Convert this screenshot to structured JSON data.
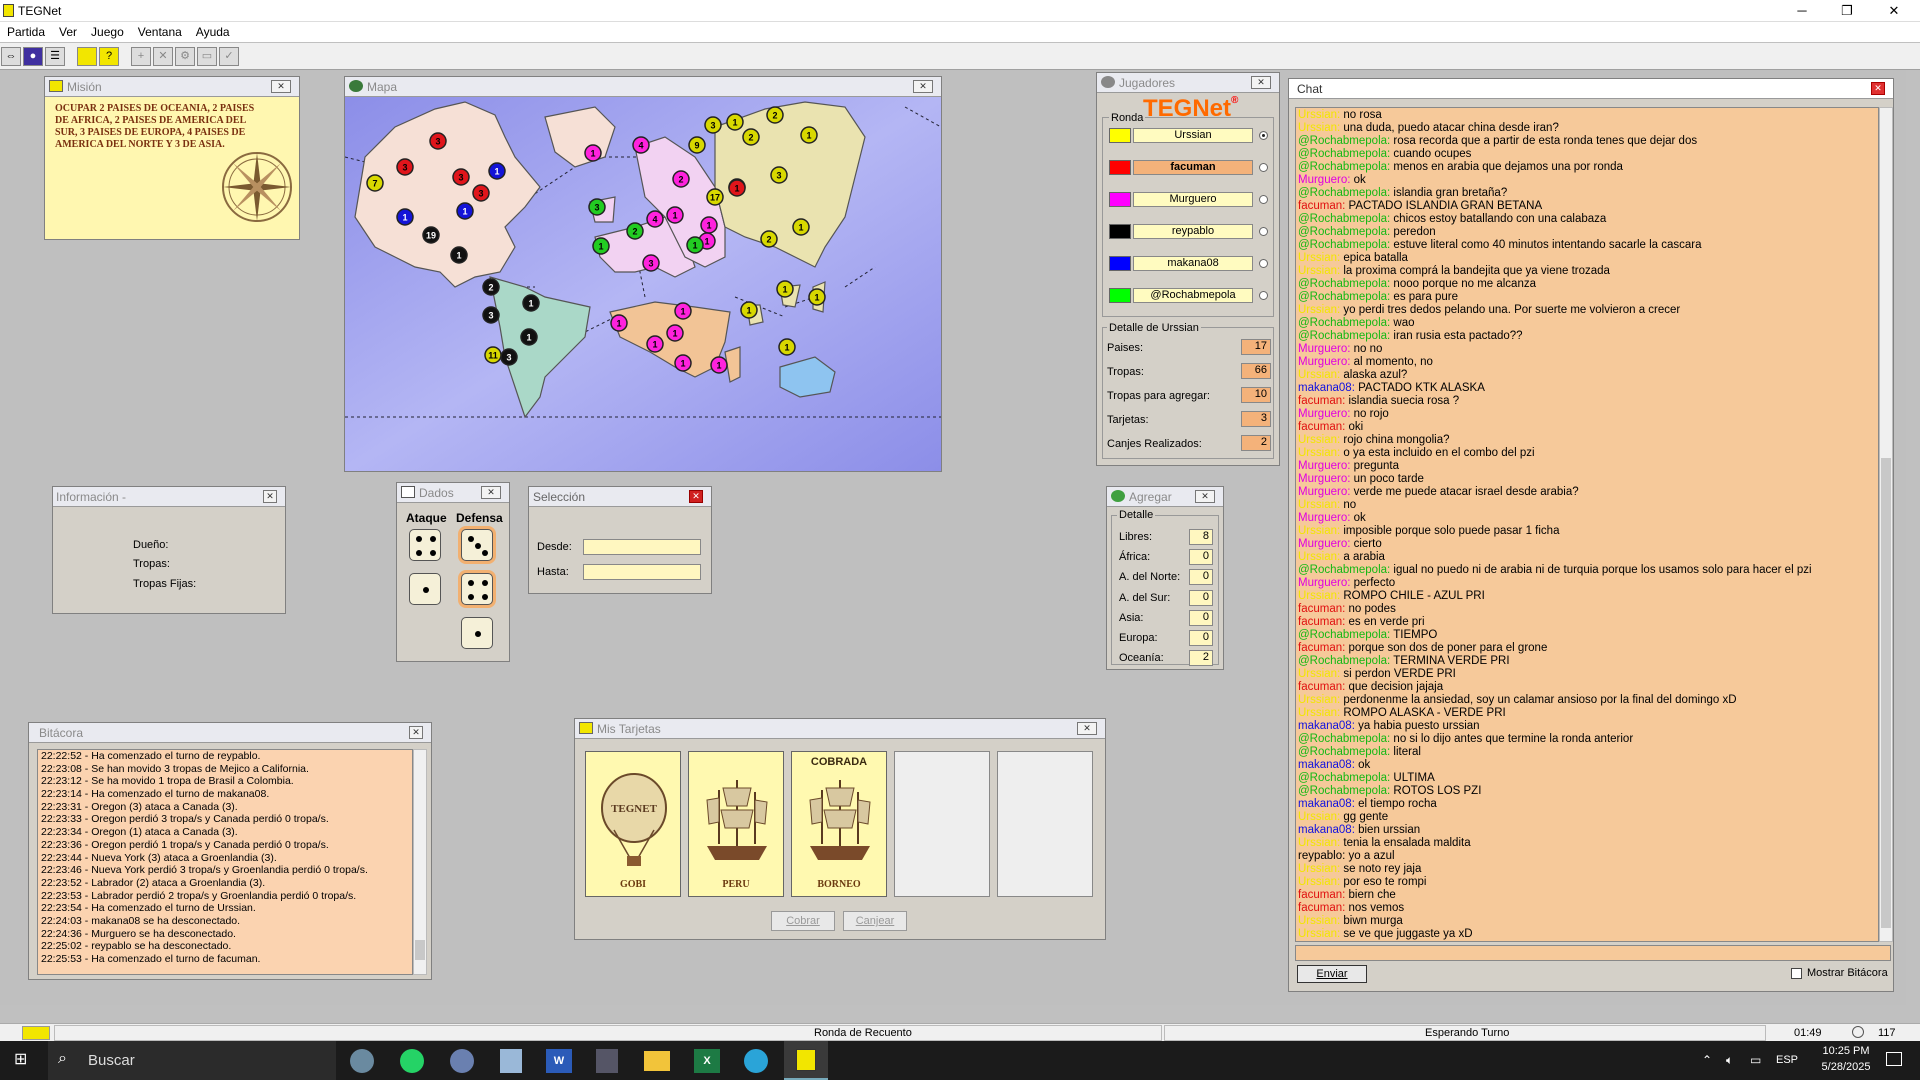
{
  "window": {
    "title": "TEGNet",
    "min": "─",
    "max": "❐",
    "close": "✕"
  },
  "menu": [
    "Partida",
    "Ver",
    "Juego",
    "Ventana",
    "Ayuda"
  ],
  "mission": {
    "title": "Misión",
    "text": "OCUPAR 2 PAISES DE OCEANIA, 2 PAISES DE AFRICA, 2 PAISES DE AMERICA DEL SUR, 3 PAISES DE EUROPA, 4 PAISES DE AMERICA DEL NORTE Y 3 DE ASIA."
  },
  "map": {
    "title": "Mapa",
    "tokens": [
      {
        "n": "3",
        "c": "#e0151b"
      },
      {
        "n": "3",
        "c": "#e0151b"
      },
      {
        "n": "3",
        "c": "#e0151b"
      },
      {
        "n": "3",
        "c": "#e0151b"
      },
      {
        "n": "7",
        "c": "#d8d800"
      },
      {
        "n": "1",
        "c": "#1414d8"
      },
      {
        "n": "1",
        "c": "#1414d8"
      },
      {
        "n": "1",
        "c": "#1414d8"
      },
      {
        "n": "19",
        "c": "#111"
      },
      {
        "n": "1",
        "c": "#111"
      },
      {
        "n": "2",
        "c": "#111"
      },
      {
        "n": "1",
        "c": "#111"
      },
      {
        "n": "3",
        "c": "#111"
      },
      {
        "n": "1",
        "c": "#111"
      },
      {
        "n": "3",
        "c": "#111"
      },
      {
        "n": "11",
        "c": "#d8d800"
      },
      {
        "n": "1",
        "c": "#ff22dd"
      },
      {
        "n": "4",
        "c": "#ff22dd"
      },
      {
        "n": "2",
        "c": "#ff22dd"
      },
      {
        "n": "4",
        "c": "#ff22dd"
      },
      {
        "n": "1",
        "c": "#ff22dd"
      },
      {
        "n": "1",
        "c": "#ff22dd"
      },
      {
        "n": "1",
        "c": "#ff22dd"
      },
      {
        "n": "3",
        "c": "#ff22dd"
      },
      {
        "n": "3",
        "c": "#22cc22"
      },
      {
        "n": "2",
        "c": "#22cc22"
      },
      {
        "n": "1",
        "c": "#22cc22"
      },
      {
        "n": "1",
        "c": "#22cc22"
      },
      {
        "n": "3",
        "c": "#d8d800"
      },
      {
        "n": "1",
        "c": "#d8d800"
      },
      {
        "n": "2",
        "c": "#d8d800"
      },
      {
        "n": "9",
        "c": "#d8d800"
      },
      {
        "n": "2",
        "c": "#d8d800"
      },
      {
        "n": "1",
        "c": "#d8d800"
      },
      {
        "n": "1",
        "c": "#d8d800"
      },
      {
        "n": "17",
        "c": "#d8d800"
      },
      {
        "n": "1",
        "c": "#e0151b"
      },
      {
        "n": "3",
        "c": "#d8d800"
      },
      {
        "n": "2",
        "c": "#d8d800"
      },
      {
        "n": "1",
        "c": "#d8d800"
      },
      {
        "n": "1",
        "c": "#ff22dd"
      },
      {
        "n": "1",
        "c": "#ff22dd"
      },
      {
        "n": "1",
        "c": "#ff22dd"
      },
      {
        "n": "1",
        "c": "#ff22dd"
      },
      {
        "n": "1",
        "c": "#ff22dd"
      },
      {
        "n": "1",
        "c": "#ff22dd"
      },
      {
        "n": "1",
        "c": "#d8d800"
      },
      {
        "n": "1",
        "c": "#d8d800"
      },
      {
        "n": "1",
        "c": "#d8d800"
      },
      {
        "n": "1",
        "c": "#d8d800"
      }
    ]
  },
  "players": {
    "title": "Jugadores",
    "logo": "TEGNet",
    "ronda": "Ronda",
    "list": [
      {
        "name": "Urssian",
        "color": "#ffff00",
        "bg": "#fffbc0"
      },
      {
        "name": "facuman",
        "color": "#ff0000",
        "bg": "#f4b27a"
      },
      {
        "name": "Murguero",
        "color": "#ff00ff",
        "bg": "#fffbc0"
      },
      {
        "name": "reypablo",
        "color": "#000000",
        "bg": "#fffbc0"
      },
      {
        "name": "makana08",
        "color": "#0000ff",
        "bg": "#fffbc0"
      },
      {
        "name": "@Rochabmepola",
        "color": "#00ff00",
        "bg": "#fffbc0"
      }
    ],
    "detail_title": "Detalle de Urssian",
    "detail": [
      {
        "k": "Paises:",
        "v": "17"
      },
      {
        "k": "Tropas:",
        "v": "66"
      },
      {
        "k": "Tropas para agregar:",
        "v": "10"
      },
      {
        "k": "Tarjetas:",
        "v": "3"
      },
      {
        "k": "Canjes Realizados:",
        "v": "2"
      }
    ]
  },
  "info": {
    "title": "Información -",
    "dueno": "Dueño:",
    "tropas": "Tropas:",
    "fijas": "Tropas Fijas:"
  },
  "dados": {
    "title": "Dados",
    "ataque": "Ataque",
    "defensa": "Defensa",
    "atk": [
      4,
      1
    ],
    "def": [
      3,
      4,
      1
    ]
  },
  "seleccion": {
    "title": "Selección",
    "desde": "Desde:",
    "hasta": "Hasta:"
  },
  "agregar": {
    "title": "Agregar",
    "detalle": "Detalle",
    "rows": [
      {
        "k": "Libres:",
        "v": "8"
      },
      {
        "k": "África:",
        "v": "0"
      },
      {
        "k": "A. del Norte:",
        "v": "0"
      },
      {
        "k": "A. del Sur:",
        "v": "0"
      },
      {
        "k": "Asia:",
        "v": "0"
      },
      {
        "k": "Europa:",
        "v": "0"
      },
      {
        "k": "Oceanía:",
        "v": "2"
      }
    ]
  },
  "bitacora": {
    "title": "Bitácora",
    "lines": [
      "22:22:52 - Ha comenzado el turno de reypablo.",
      "22:23:08 - Se han movido 3 tropas de Mejico a California.",
      "22:23:12 - Se ha movido 1 tropa de Brasil a Colombia.",
      "22:23:14 - Ha comenzado el turno de makana08.",
      "22:23:31 - Oregon (3) ataca a Canada (3).",
      "22:23:33 - Oregon perdió 3 tropa/s y Canada perdió 0 tropa/s.",
      "22:23:34 - Oregon (1) ataca a Canada (3).",
      "22:23:36 - Oregon perdió 1 tropa/s y Canada perdió 0 tropa/s.",
      "22:23:44 - Nueva York (3) ataca a Groenlandia (3).",
      "22:23:46 - Nueva York perdió 3 tropa/s y Groenlandia perdió 0 tropa/s.",
      "22:23:52 - Labrador (2) ataca a Groenlandia (3).",
      "22:23:53 - Labrador perdió 2 tropa/s y Groenlandia perdió 0 tropa/s.",
      "22:23:54 - Ha comenzado el turno de Urssian.",
      "22:24:03 - makana08 se ha desconectado.",
      "22:24:36 - Murguero se ha desconectado.",
      "22:25:02 - reypablo se ha desconectado.",
      "22:25:53 - Ha comenzado el turno de facuman."
    ]
  },
  "tarjetas": {
    "title": "Mis Tarjetas",
    "cards": [
      {
        "name": "GOBI",
        "top": "",
        "pic": "balloon"
      },
      {
        "name": "PERU",
        "top": "",
        "pic": "ship"
      },
      {
        "name": "BORNEO",
        "top": "COBRADA",
        "pic": "ship"
      }
    ],
    "cobrar": "Cobrar",
    "canjear": "Canjear"
  },
  "chat": {
    "title": "Chat",
    "send": "Enviar",
    "mostrar": "Mostrar Bitácora",
    "lines": [
      {
        "u": "Urssian",
        "t": "no rosa",
        "c": "#f2e600"
      },
      {
        "u": "Urssian",
        "t": "una duda, puedo atacar china desde iran?",
        "c": "#f2e600"
      },
      {
        "u": "@Rochabmepola",
        "t": "rosa recorda que a partir de esta ronda tenes que dejar dos",
        "c": "#14b814"
      },
      {
        "u": "@Rochabmepola",
        "t": "cuando ocupes",
        "c": "#14b814"
      },
      {
        "u": "@Rochabmepola",
        "t": "menos en arabia que dejamos una por ronda",
        "c": "#14b814"
      },
      {
        "u": "Murguero",
        "t": "ok",
        "c": "#e000e0"
      },
      {
        "u": "@Rochabmepola",
        "t": "islandia gran bretaña?",
        "c": "#14b814"
      },
      {
        "u": "facuman",
        "t": "PACTADO ISLANDIA GRAN BETANA",
        "c": "#e01010"
      },
      {
        "u": "@Rochabmepola",
        "t": "chicos estoy batallando con una calabaza",
        "c": "#14b814"
      },
      {
        "u": "@Rochabmepola",
        "t": "peredon",
        "c": "#14b814"
      },
      {
        "u": "@Rochabmepola",
        "t": "estuve literal como 40 minutos intentando sacarle la cascara",
        "c": "#14b814"
      },
      {
        "u": "Urssian",
        "t": "epica batalla",
        "c": "#f2e600"
      },
      {
        "u": "Urssian",
        "t": "la proxima comprá la bandejita que ya viene trozada",
        "c": "#f2e600"
      },
      {
        "u": "@Rochabmepola",
        "t": "nooo porque no me alcanza",
        "c": "#14b814"
      },
      {
        "u": "@Rochabmepola",
        "t": "es para pure",
        "c": "#14b814"
      },
      {
        "u": "Urssian",
        "t": "yo perdi tres dedos pelando una. Por suerte me volvieron a crecer",
        "c": "#f2e600"
      },
      {
        "u": "@Rochabmepola",
        "t": "wao",
        "c": "#14b814"
      },
      {
        "u": "@Rochabmepola",
        "t": "iran rusia esta pactado??",
        "c": "#14b814"
      },
      {
        "u": "Murguero",
        "t": "no no",
        "c": "#e000e0"
      },
      {
        "u": "Murguero",
        "t": "al momento, no",
        "c": "#e000e0"
      },
      {
        "u": "Urssian",
        "t": "alaska azul?",
        "c": "#f2e600"
      },
      {
        "u": "makana08",
        "t": "PACTADO KTK ALASKA",
        "c": "#1010e0"
      },
      {
        "u": "facuman",
        "t": "islandia suecia rosa ?",
        "c": "#e01010"
      },
      {
        "u": "Murguero",
        "t": "no rojo",
        "c": "#e000e0"
      },
      {
        "u": "facuman",
        "t": "oki",
        "c": "#e01010"
      },
      {
        "u": "Urssian",
        "t": "rojo china mongolia?",
        "c": "#f2e600"
      },
      {
        "u": "Urssian",
        "t": "o ya esta incluido en el combo del pzi",
        "c": "#f2e600"
      },
      {
        "u": "Murguero",
        "t": "pregunta",
        "c": "#e000e0"
      },
      {
        "u": "Murguero",
        "t": "un poco tarde",
        "c": "#e000e0"
      },
      {
        "u": "Murguero",
        "t": "verde me puede atacar israel desde arabia?",
        "c": "#e000e0"
      },
      {
        "u": "Urssian",
        "t": "no",
        "c": "#f2e600"
      },
      {
        "u": "Murguero",
        "t": "ok",
        "c": "#e000e0"
      },
      {
        "u": "Urssian",
        "t": "imposible porque solo puede pasar 1 ficha",
        "c": "#f2e600"
      },
      {
        "u": "Murguero",
        "t": "cierto",
        "c": "#e000e0"
      },
      {
        "u": "Urssian",
        "t": "a arabia",
        "c": "#f2e600"
      },
      {
        "u": "@Rochabmepola",
        "t": "igual no puedo ni de arabia ni de turquia porque los usamos solo para hacer el pzi",
        "c": "#14b814"
      },
      {
        "u": "Murguero",
        "t": "perfecto",
        "c": "#e000e0"
      },
      {
        "u": "Urssian",
        "t": "ROMPO CHILE - AZUL PRI",
        "c": "#f2e600"
      },
      {
        "u": "facuman",
        "t": "no podes",
        "c": "#e01010"
      },
      {
        "u": "facuman",
        "t": "es en verde pri",
        "c": "#e01010"
      },
      {
        "u": "@Rochabmepola",
        "t": "TIEMPO",
        "c": "#14b814"
      },
      {
        "u": "facuman",
        "t": "porque son dos de poner para el grone",
        "c": "#e01010"
      },
      {
        "u": "@Rochabmepola",
        "t": "TERMINA VERDE PRI",
        "c": "#14b814"
      },
      {
        "u": "Urssian",
        "t": "si perdon VERDE PRI",
        "c": "#f2e600"
      },
      {
        "u": "facuman",
        "t": "que decision jajaja",
        "c": "#e01010"
      },
      {
        "u": "Urssian",
        "t": "perdonenme la ansiedad, soy un calamar ansioso por la final del domingo xD",
        "c": "#f2e600"
      },
      {
        "u": "Urssian",
        "t": "ROMPO ALASKA - VERDE PRI",
        "c": "#f2e600"
      },
      {
        "u": "makana08",
        "t": "ya habia puesto urssian",
        "c": "#1010e0"
      },
      {
        "u": "@Rochabmepola",
        "t": "no si lo dijo antes que termine la ronda anterior",
        "c": "#14b814"
      },
      {
        "u": "@Rochabmepola",
        "t": "literal",
        "c": "#14b814"
      },
      {
        "u": "makana08",
        "t": "ok",
        "c": "#1010e0"
      },
      {
        "u": "@Rochabmepola",
        "t": "ULTIMA",
        "c": "#14b814"
      },
      {
        "u": "@Rochabmepola",
        "t": "ROTOS LOS PZI",
        "c": "#14b814"
      },
      {
        "u": "makana08",
        "t": "el tiempo rocha",
        "c": "#1010e0"
      },
      {
        "u": "Urssian",
        "t": "gg gente",
        "c": "#f2e600"
      },
      {
        "u": "makana08",
        "t": "bien urssian",
        "c": "#1010e0"
      },
      {
        "u": "Urssian",
        "t": "tenia la ensalada maldita",
        "c": "#f2e600"
      },
      {
        "u": "reypablo",
        "t": "yo a  azul",
        "c": "#000000"
      },
      {
        "u": "Urssian",
        "t": "se noto rey jaja",
        "c": "#f2e600"
      },
      {
        "u": "Urssian",
        "t": "por eso te rompi",
        "c": "#f2e600"
      },
      {
        "u": "facuman",
        "t": "biern che",
        "c": "#e01010"
      },
      {
        "u": "facuman",
        "t": "nos vemos",
        "c": "#e01010"
      },
      {
        "u": "Urssian",
        "t": "biwn murga",
        "c": "#f2e600"
      },
      {
        "u": "Urssian",
        "t": "se ve que juggaste ya xD",
        "c": "#f2e600"
      }
    ]
  },
  "status": {
    "ronda": "Ronda de Recuento",
    "esperando": "Esperando Turno",
    "time": "01:49",
    "count": "117"
  },
  "taskbar": {
    "search": "Buscar",
    "lang": "ESP",
    "clock": "10:25 PM",
    "date": "5/28/2025"
  }
}
